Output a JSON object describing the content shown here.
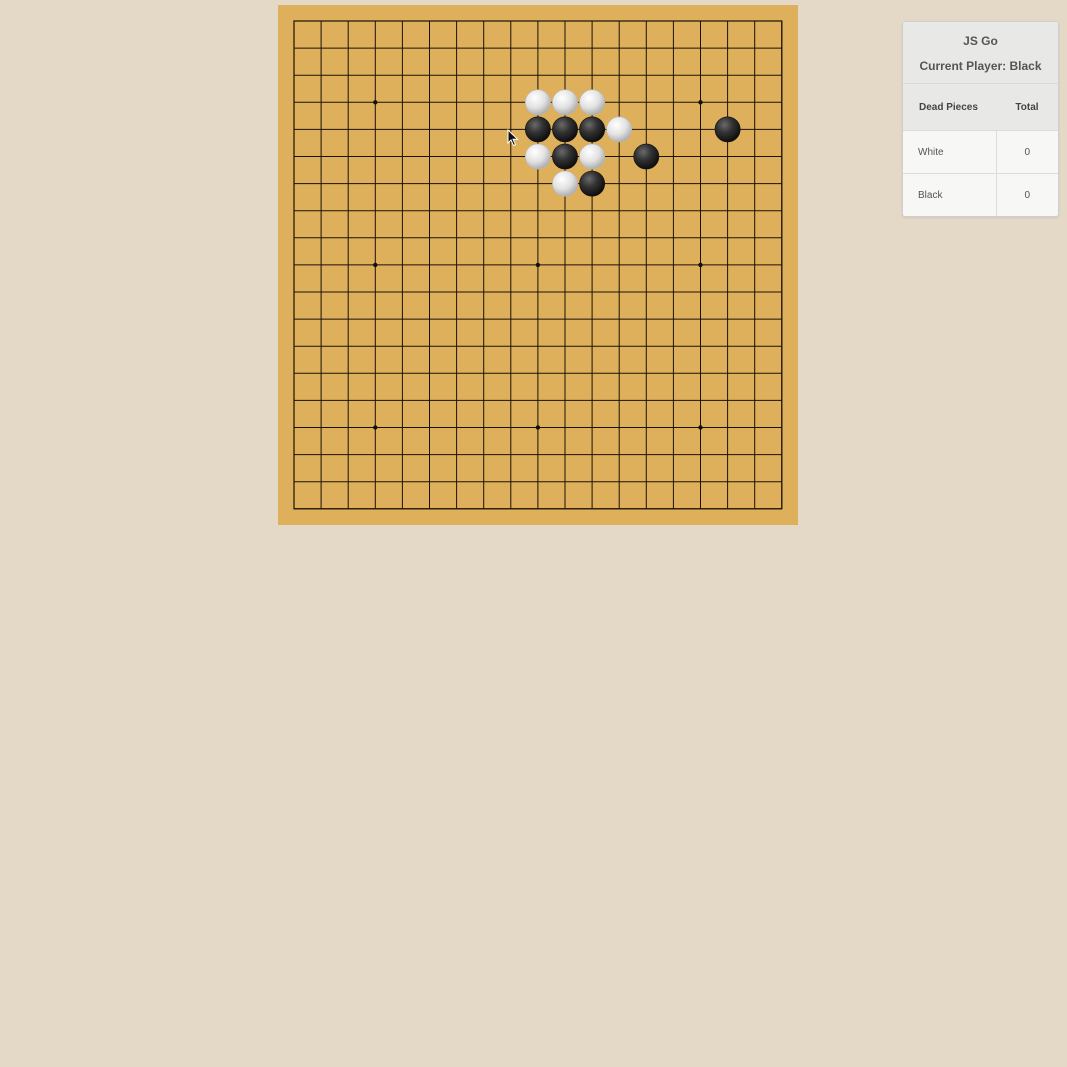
{
  "board": {
    "size": 19,
    "star_points": [
      [
        3,
        3
      ],
      [
        3,
        9
      ],
      [
        3,
        15
      ],
      [
        9,
        3
      ],
      [
        9,
        9
      ],
      [
        9,
        15
      ],
      [
        15,
        3
      ],
      [
        15,
        9
      ],
      [
        15,
        15
      ]
    ],
    "stones": [
      {
        "row": 3,
        "col": 9,
        "color": "white"
      },
      {
        "row": 3,
        "col": 10,
        "color": "white"
      },
      {
        "row": 3,
        "col": 11,
        "color": "white"
      },
      {
        "row": 4,
        "col": 9,
        "color": "black"
      },
      {
        "row": 4,
        "col": 10,
        "color": "black"
      },
      {
        "row": 4,
        "col": 11,
        "color": "black"
      },
      {
        "row": 4,
        "col": 12,
        "color": "white"
      },
      {
        "row": 4,
        "col": 16,
        "color": "black"
      },
      {
        "row": 5,
        "col": 9,
        "color": "white"
      },
      {
        "row": 5,
        "col": 10,
        "color": "black"
      },
      {
        "row": 5,
        "col": 11,
        "color": "white"
      },
      {
        "row": 5,
        "col": 13,
        "color": "black"
      },
      {
        "row": 6,
        "col": 10,
        "color": "white"
      },
      {
        "row": 6,
        "col": 11,
        "color": "black"
      }
    ],
    "colors": {
      "wood": "#deb05c",
      "line": "#1a1208",
      "background": "#e4d9c6"
    }
  },
  "panel": {
    "title": "JS Go",
    "current_player_label": "Current Player: Black",
    "table": {
      "headers": [
        "Dead Pieces",
        "Total"
      ],
      "rows": [
        {
          "player": "White",
          "total": "0"
        },
        {
          "player": "Black",
          "total": "0"
        }
      ]
    }
  },
  "cursor_icon": "arrow-pointer-icon"
}
